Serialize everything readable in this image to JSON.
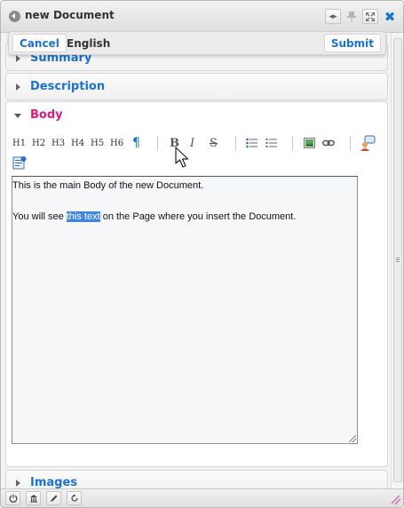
{
  "window": {
    "title": "new Document",
    "titlebar_buttons": [
      "collapse-horizontal-icon",
      "pin-icon",
      "maximize-icon",
      "close-icon"
    ],
    "close_glyph": "✖"
  },
  "actionbar": {
    "cancel_label": "Cancel",
    "language": "English",
    "submit_label": "Submit"
  },
  "sections": {
    "summary": "Summary",
    "description": "Description",
    "body": "Body",
    "images": "Images"
  },
  "toolbar": {
    "h1": "H1",
    "h2": "H2",
    "h3": "H3",
    "h4": "H4",
    "h5": "H5",
    "h6": "H6",
    "paragraph": "¶",
    "bold": "B",
    "italic": "I",
    "strike": "S"
  },
  "editor": {
    "line1": "This is the main Body of the new Document.",
    "line2_before": "You will see ",
    "line2_selected": "this text",
    "line2_after": " on the Page where you insert the Document."
  },
  "statusbar": {
    "buttons": [
      "power-icon",
      "building-icon",
      "edit-pencil-icon",
      "refresh-icon"
    ]
  },
  "colors": {
    "accent": "#1a73d1",
    "active_section": "#e0197e",
    "selection": "#3f86df"
  }
}
